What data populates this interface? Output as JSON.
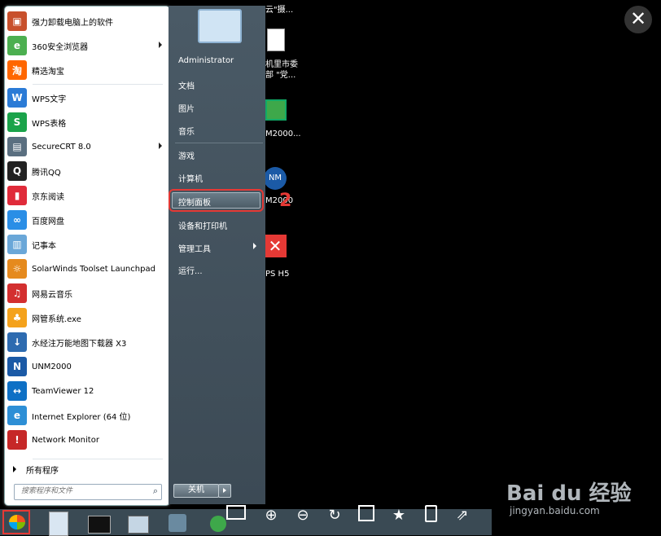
{
  "left_menu": {
    "items": [
      {
        "label": "强力卸载电脑上的软件",
        "color": "#c8502c",
        "glyph": "▣"
      },
      {
        "label": "360安全浏览器",
        "color": "#4caf50",
        "glyph": "e",
        "arrow": true
      },
      {
        "label": "精选淘宝",
        "color": "#ff6600",
        "glyph": "淘"
      },
      {
        "label": "WPS文字",
        "color": "#2b7bd6",
        "glyph": "W"
      },
      {
        "label": "WPS表格",
        "color": "#1aa34a",
        "glyph": "S"
      },
      {
        "label": "SecureCRT 8.0",
        "color": "#5a6f80",
        "glyph": "▤",
        "arrow": true
      },
      {
        "label": "腾讯QQ",
        "color": "#222222",
        "glyph": "Q"
      },
      {
        "label": "京东阅读",
        "color": "#e02b3a",
        "glyph": "▮"
      },
      {
        "label": "百度网盘",
        "color": "#2a8ee6",
        "glyph": "∞"
      },
      {
        "label": "记事本",
        "color": "#6aa7d8",
        "glyph": "▥"
      },
      {
        "label": "SolarWinds Toolset Launchpad",
        "color": "#e58a1e",
        "glyph": "☼"
      },
      {
        "label": "网易云音乐",
        "color": "#d32f2f",
        "glyph": "♫"
      },
      {
        "label": "网管系统.exe",
        "color": "#f4a21c",
        "glyph": "♣"
      },
      {
        "label": "水经注万能地图下载器 X3",
        "color": "#2d6bb0",
        "glyph": "↓"
      },
      {
        "label": "UNM2000",
        "color": "#1b5aa6",
        "glyph": "N"
      },
      {
        "label": "TeamViewer 12",
        "color": "#0e70c5",
        "glyph": "↔"
      },
      {
        "label": "Internet Explorer (64 位)",
        "color": "#2d8fd6",
        "glyph": "e"
      },
      {
        "label": "Network Monitor",
        "color": "#c62828",
        "glyph": "!"
      }
    ],
    "all_programs": "所有程序",
    "search_placeholder": "搜索程序和文件"
  },
  "right_menu": {
    "user": "Administrator",
    "items": [
      "文档",
      "图片",
      "音乐",
      "游戏",
      "计算机",
      "控制面板",
      "设备和打印机",
      "管理工具",
      "运行..."
    ],
    "shutdown": "关机"
  },
  "desktop_icons": [
    "云\"摄...",
    "机里市委部 \"党...",
    "M2000...",
    "M2000",
    "PS H5"
  ],
  "annotation_number": "2",
  "colors": {
    "highlight_red": "#e53935",
    "menu_blue": "#4a5a66"
  },
  "watermark": {
    "brand": "Bai du 经验",
    "url": "jingyan.baidu.com"
  }
}
